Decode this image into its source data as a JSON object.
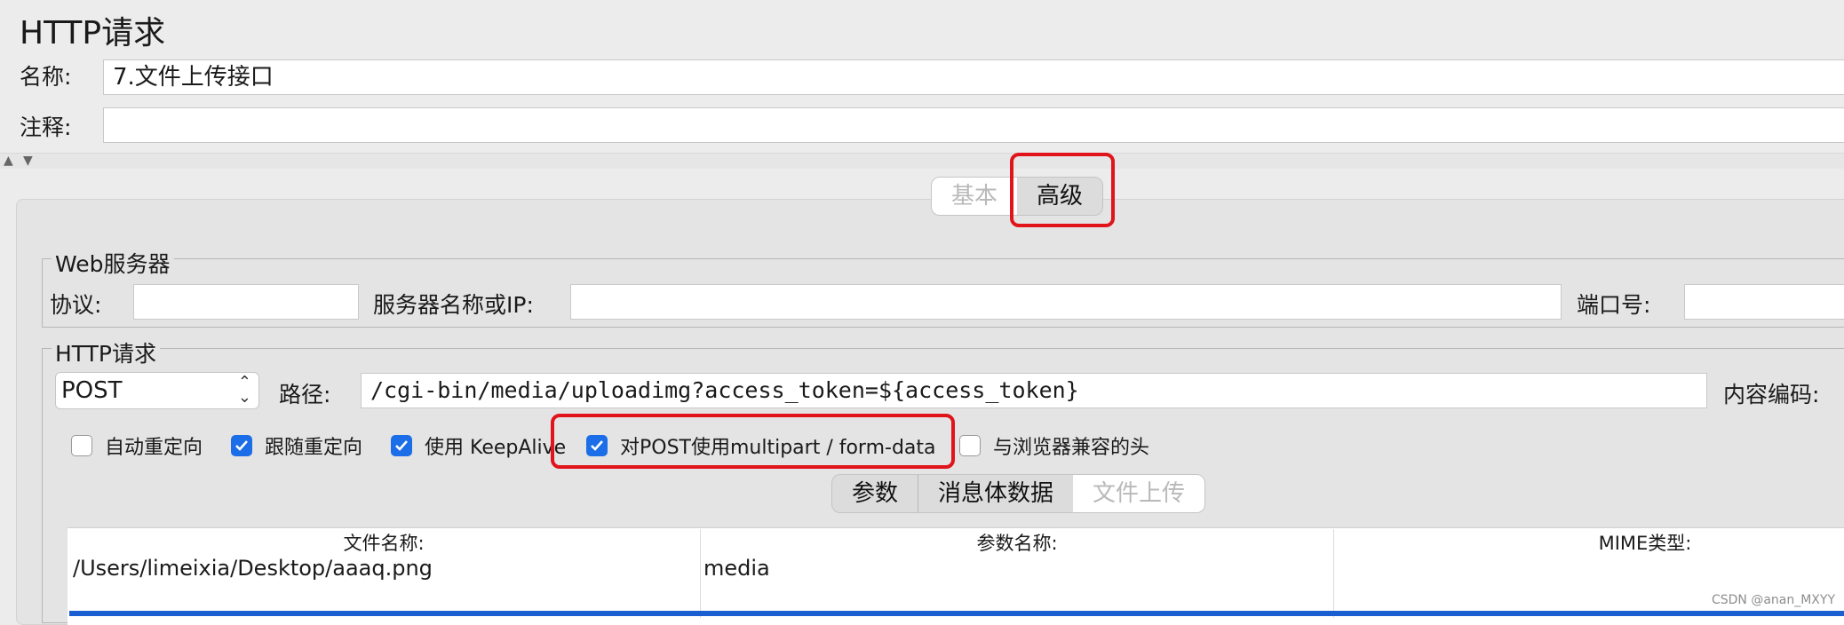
{
  "title": "HTTP请求",
  "name": {
    "label": "名称:",
    "value": "7.文件上传接口"
  },
  "comment": {
    "label": "注释:",
    "value": ""
  },
  "tabs": {
    "basic": "基本",
    "advanced": "高级"
  },
  "web_server": {
    "legend": "Web服务器",
    "protocol_label": "协议:",
    "protocol_value": "",
    "server_label": "服务器名称或IP:",
    "server_value": "",
    "port_label": "端口号:",
    "port_value": ""
  },
  "http_request": {
    "legend": "HTTP请求",
    "method": "POST",
    "path_label": "路径:",
    "path_value": "/cgi-bin/media/uploadimg?access_token=${access_token}",
    "encoding_label": "内容编码:"
  },
  "options": [
    {
      "label": "自动重定向",
      "checked": false
    },
    {
      "label": "跟随重定向",
      "checked": true
    },
    {
      "label": "使用 KeepAlive",
      "checked": true
    },
    {
      "label": "对POST使用multipart / form-data",
      "checked": true
    },
    {
      "label": "与浏览器兼容的头",
      "checked": false
    }
  ],
  "subtabs": {
    "params": "参数",
    "body": "消息体数据",
    "files": "文件上传"
  },
  "table": {
    "headers": [
      "文件名称:",
      "参数名称:",
      "MIME类型:"
    ],
    "rows": [
      [
        "/Users/limeixia/Desktop/aaaq.png",
        "media",
        ""
      ]
    ]
  },
  "watermark": "CSDN @anan_MXYY",
  "colors": {
    "highlight": "#e0141a",
    "check": "#1b6ee8",
    "selection": "#1a5fd1"
  },
  "icons": {
    "collapse": "triangle-up-icon",
    "expand": "triangle-down-icon",
    "combo": "chevron-updown-icon"
  }
}
